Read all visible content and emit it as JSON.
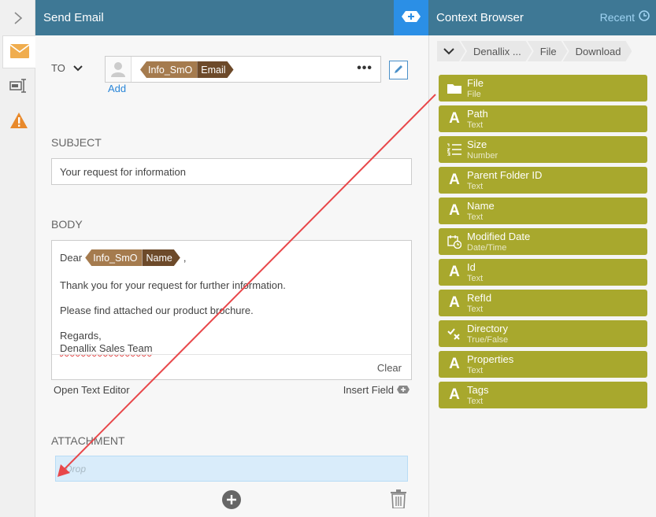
{
  "header": {
    "title": "Send Email",
    "context_title": "Context Browser",
    "recent_label": "Recent"
  },
  "to": {
    "label": "TO",
    "tag_source": "Info_SmO",
    "tag_field": "Email",
    "add_label": "Add"
  },
  "subject": {
    "label": "SUBJECT",
    "value": "Your request for information"
  },
  "body": {
    "label": "BODY",
    "greeting": "Dear",
    "tag_source": "Info_SmO",
    "tag_field": "Name",
    "comma": ",",
    "line1": "Thank you for your request for further information.",
    "line2": "Please find attached our product brochure.",
    "line3": "Regards,",
    "line4": "Denallix Sales Team",
    "clear_label": "Clear",
    "open_editor_label": "Open Text Editor",
    "insert_field_label": "Insert Field"
  },
  "attachment": {
    "label": "ATTACHMENT",
    "drop_placeholder": "Drop"
  },
  "breadcrumb": [
    "Denallix ...",
    "File",
    "Download"
  ],
  "fields": [
    {
      "name": "File",
      "type": "File",
      "icon": "folder-icon"
    },
    {
      "name": "Path",
      "type": "Text",
      "icon": "text-icon"
    },
    {
      "name": "Size",
      "type": "Number",
      "icon": "number-icon"
    },
    {
      "name": "Parent Folder ID",
      "type": "Text",
      "icon": "text-icon"
    },
    {
      "name": "Name",
      "type": "Text",
      "icon": "text-icon"
    },
    {
      "name": "Modified Date",
      "type": "Date/Time",
      "icon": "datetime-icon"
    },
    {
      "name": "Id",
      "type": "Text",
      "icon": "text-icon"
    },
    {
      "name": "RefId",
      "type": "Text",
      "icon": "text-icon"
    },
    {
      "name": "Directory",
      "type": "True/False",
      "icon": "boolean-icon"
    },
    {
      "name": "Properties",
      "type": "Text",
      "icon": "text-icon"
    },
    {
      "name": "Tags",
      "type": "Text",
      "icon": "text-icon"
    }
  ],
  "colors": {
    "header": "#3e7895",
    "accent_blue": "#2b8fe6",
    "field_olive": "#a8a82d",
    "tag_light": "#a57b4e",
    "tag_dark": "#6d4a2a",
    "warning": "#e8892b",
    "arrow": "#e8474a"
  }
}
